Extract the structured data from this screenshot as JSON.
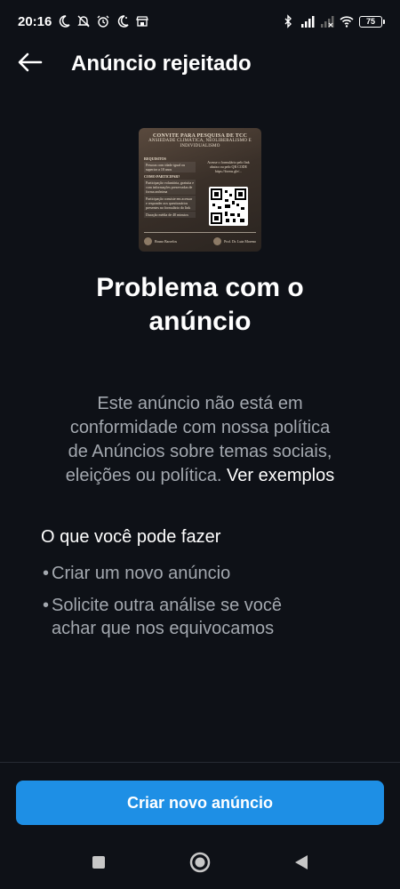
{
  "status_bar": {
    "time": "20:16",
    "battery_level": "75",
    "left_icons": [
      "moon-icon",
      "notifications-off-icon",
      "alarm-icon",
      "moon-icon",
      "store-icon"
    ],
    "right_icons": [
      "bluetooth-icon",
      "signal-icon",
      "signal-off-icon",
      "wifi-icon",
      "battery-icon"
    ]
  },
  "header": {
    "title": "Anúncio rejeitado",
    "back_icon": "arrow-left-icon"
  },
  "ad_preview": {
    "headline_1": "CONVITE PARA PESQUISA DE TCC",
    "headline_2": "ANSIEDADE CLIMÁTICA, NEOLIBERALISMO E",
    "headline_3": "INDIVIDUALISMO",
    "requisitos_label": "REQUISITOS",
    "requisitos_text": "Pessoas com idade igual ou superior a 18 anos",
    "como_label": "COMO PARTICIPAR?",
    "como_text": "Participação voluntária, gratuita e com informações preservadas de forma anônima",
    "contato_text": "Participação consiste em acessar e responder aos questionários presentes no formulário do link",
    "duracao_text": "Duração média de 40 minutos",
    "acesse_text": "Acesse o formulário pelo link abaixo ou pelo QR CODE",
    "link_text": "https://forms.gle/...",
    "author_1": "Bruno Barcelos",
    "author_2": "Prof. Dr. Luiz Moreno"
  },
  "main": {
    "title_line_1": "Problema com o",
    "title_line_2": "anúncio",
    "description_lines": [
      "Este anúncio não está em",
      "conformidade com nossa política",
      "de Anúncios sobre temas sociais,",
      "eleições ou política."
    ],
    "description_link": "Ver exemplos",
    "options_title": "O que você pode fazer",
    "bullet_char": "•",
    "options": [
      {
        "lines": [
          "Criar um novo anúncio"
        ]
      },
      {
        "lines": [
          "Solicite outra análise se você",
          "achar que nos equivocamos"
        ]
      }
    ]
  },
  "footer": {
    "cta_label": "Criar novo anúncio"
  },
  "nav_bar": {
    "icons": [
      "recents-square-icon",
      "home-circle-icon",
      "back-triangle-icon"
    ]
  },
  "colors": {
    "background": "#0e1117",
    "accent": "#1e8fe5",
    "secondary_text": "#a3a8af"
  }
}
